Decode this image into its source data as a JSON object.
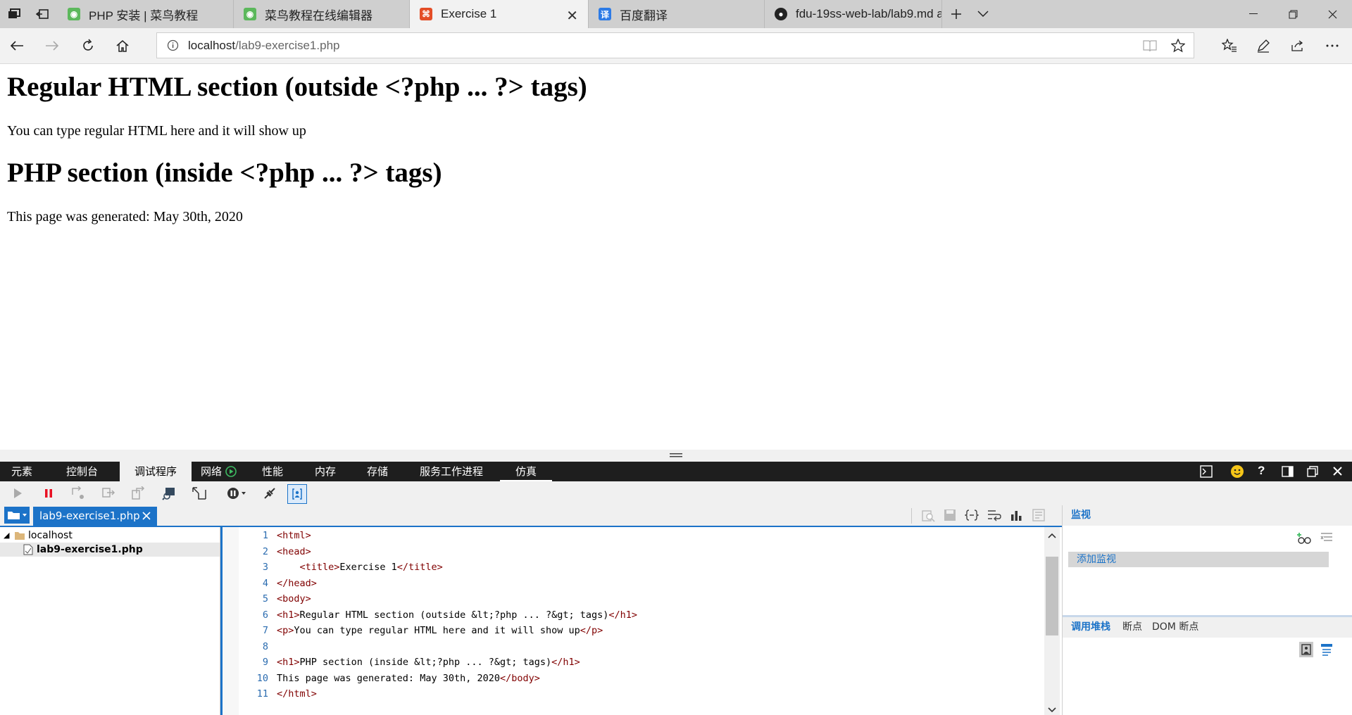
{
  "browser": {
    "tabs": [
      {
        "title": "PHP 安装 | 菜鸟教程",
        "icon": "runoob-icon"
      },
      {
        "title": "菜鸟教程在线编辑器",
        "icon": "runoob-icon"
      },
      {
        "title": "Exercise 1",
        "icon": "html-file-icon",
        "active": true
      },
      {
        "title": "百度翻译",
        "icon": "baidu-translate-icon"
      },
      {
        "title": "fdu-19ss-web-lab/lab9.md a",
        "icon": "github-icon"
      }
    ],
    "url_host": "localhost",
    "url_path": "/lab9-exercise1.php"
  },
  "page": {
    "heading1": "Regular HTML section (outside <?php ... ?> tags)",
    "paragraph1": "You can type regular HTML here and it will show up",
    "heading2": "PHP section (inside <?php ... ?> tags)",
    "paragraph2": "This page was generated: May 30th, 2020"
  },
  "devtools": {
    "tabs": [
      "元素",
      "控制台",
      "调试程序",
      "网络",
      "性能",
      "内存",
      "存储",
      "服务工作进程",
      "仿真"
    ],
    "active_tab": "调试程序",
    "open_file": "lab9-exercise1.php",
    "tree": {
      "root": "localhost",
      "file": "lab9-exercise1.php"
    },
    "code_lines": [
      {
        "n": "1",
        "parts": [
          [
            "tg",
            "<html>"
          ]
        ]
      },
      {
        "n": "2",
        "parts": [
          [
            "tg",
            "<head>"
          ]
        ]
      },
      {
        "n": "3",
        "parts": [
          [
            "tx",
            "    "
          ],
          [
            "tg",
            "<title>"
          ],
          [
            "tx",
            "Exercise 1"
          ],
          [
            "tg",
            "</title>"
          ]
        ]
      },
      {
        "n": "4",
        "parts": [
          [
            "tg",
            "</head>"
          ]
        ]
      },
      {
        "n": "5",
        "parts": [
          [
            "tg",
            "<body>"
          ]
        ]
      },
      {
        "n": "6",
        "parts": [
          [
            "tg",
            "<h1>"
          ],
          [
            "tx",
            "Regular HTML section (outside &lt;?php ... ?&gt; tags)"
          ],
          [
            "tg",
            "</h1>"
          ]
        ]
      },
      {
        "n": "7",
        "parts": [
          [
            "tg",
            "<p>"
          ],
          [
            "tx",
            "You can type regular HTML here and it will show up"
          ],
          [
            "tg",
            "</p>"
          ]
        ]
      },
      {
        "n": "8",
        "parts": []
      },
      {
        "n": "9",
        "parts": [
          [
            "tg",
            "<h1>"
          ],
          [
            "tx",
            "PHP section (inside &lt;?php ... ?&gt; tags)"
          ],
          [
            "tg",
            "</h1>"
          ]
        ]
      },
      {
        "n": "10",
        "parts": [
          [
            "tx",
            "This page was generated: May 30th, 2020"
          ],
          [
            "tg",
            "</body>"
          ]
        ]
      },
      {
        "n": "11",
        "parts": [
          [
            "tg",
            "</html>"
          ]
        ]
      }
    ],
    "watch_title": "监视",
    "add_watch": "添加监视",
    "bottom_tabs": [
      "调用堆栈",
      "断点",
      "DOM 断点"
    ],
    "active_bottom_tab": "调用堆栈"
  },
  "colors": {
    "accent": "#1c73c8",
    "tag": "#800000"
  }
}
